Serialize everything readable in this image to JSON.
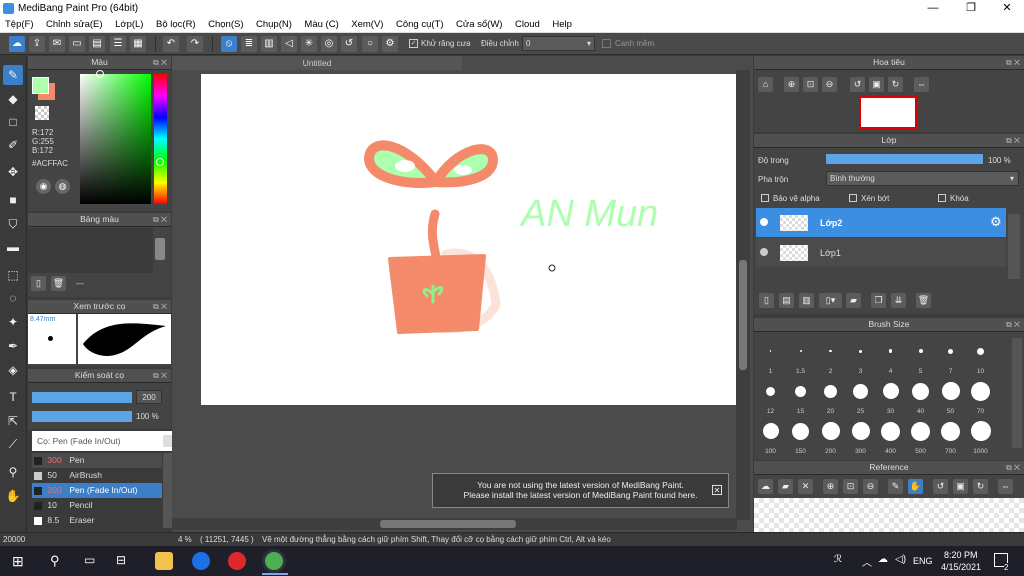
{
  "window": {
    "title": "MediBang Paint Pro (64bit)",
    "min": "—",
    "max": "❐",
    "close": "✕"
  },
  "menu": [
    "Tệp(F)",
    "Chỉnh sửa(E)",
    "Lớp(L)",
    "Bộ lọc(R)",
    "Chọn(S)",
    "Chụp(N)",
    "Màu (C)",
    "Xem(V)",
    "Công cụ(T)",
    "Cửa sổ(W)",
    "Cloud",
    "Help"
  ],
  "toolbar": {
    "antialias_label": "Khử răng cưa",
    "correction_label": "Điều chỉnh",
    "correction_value": "0",
    "snap_label": "Canh mềm"
  },
  "color_panel": {
    "title": "Màu",
    "r": "R:172",
    "g": "G:255",
    "b": "B:172",
    "hex": "#ACFFAC",
    "foreground": "#ACFFAC",
    "background": "#F48A6A"
  },
  "palette_panel": {
    "title": "Bảng màu",
    "dash": "---"
  },
  "brush_preview": {
    "title": "Xem trước cọ",
    "size": "8.47mm"
  },
  "brush_control": {
    "title": "Kiểm soát cọ",
    "size": "200",
    "opacity": "100 %"
  },
  "brush_list": {
    "current": "Cọ: Pen (Fade In/Out)",
    "items": [
      {
        "size": "300",
        "name": "Pen"
      },
      {
        "size": "50",
        "name": "AirBrush"
      },
      {
        "size": "200",
        "name": "Pen (Fade In/Out)"
      },
      {
        "size": "10",
        "name": "Pencil"
      },
      {
        "size": "8.5",
        "name": "Eraser"
      }
    ]
  },
  "canvas": {
    "tab": "Untitled",
    "handwriting": "AN Mun"
  },
  "notice": {
    "line1": "You are not using the latest version of MediBang Paint.",
    "line2": "Please install the latest version of MediBang Paint found here."
  },
  "navigator": {
    "title": "Hoa tiêu"
  },
  "layers": {
    "title": "Lớp",
    "opacity_label": "Độ trong",
    "opacity_value": "100 %",
    "blend_label": "Pha trộn",
    "blend_value": "Bình thường",
    "protect_alpha": "Bảo vệ alpha",
    "clipping": "Xén bớt",
    "lock": "Khóa",
    "items": [
      {
        "name": "Lớp2"
      },
      {
        "name": "Lớp1"
      }
    ]
  },
  "brush_size": {
    "title": "Brush Size",
    "sizes": [
      "1",
      "1.5",
      "2",
      "3",
      "4",
      "5",
      "7",
      "10",
      "12",
      "15",
      "20",
      "25",
      "30",
      "40",
      "50",
      "70",
      "100",
      "150",
      "200",
      "300",
      "400",
      "500",
      "700",
      "1000"
    ]
  },
  "reference": {
    "title": "Reference"
  },
  "status": {
    "zoom": "4 %",
    "coords": "( 11251, 7445 )",
    "hint": "Vẽ một đường thẳng bằng cách giữ phím Shift, Thay đổi cỡ cọ bằng cách giữ phím Ctrl, Alt và kéo",
    "left_value": "20000"
  },
  "taskbar": {
    "lang": "ENG",
    "time": "8:20 PM",
    "date": "4/15/2021",
    "notif": "2"
  }
}
